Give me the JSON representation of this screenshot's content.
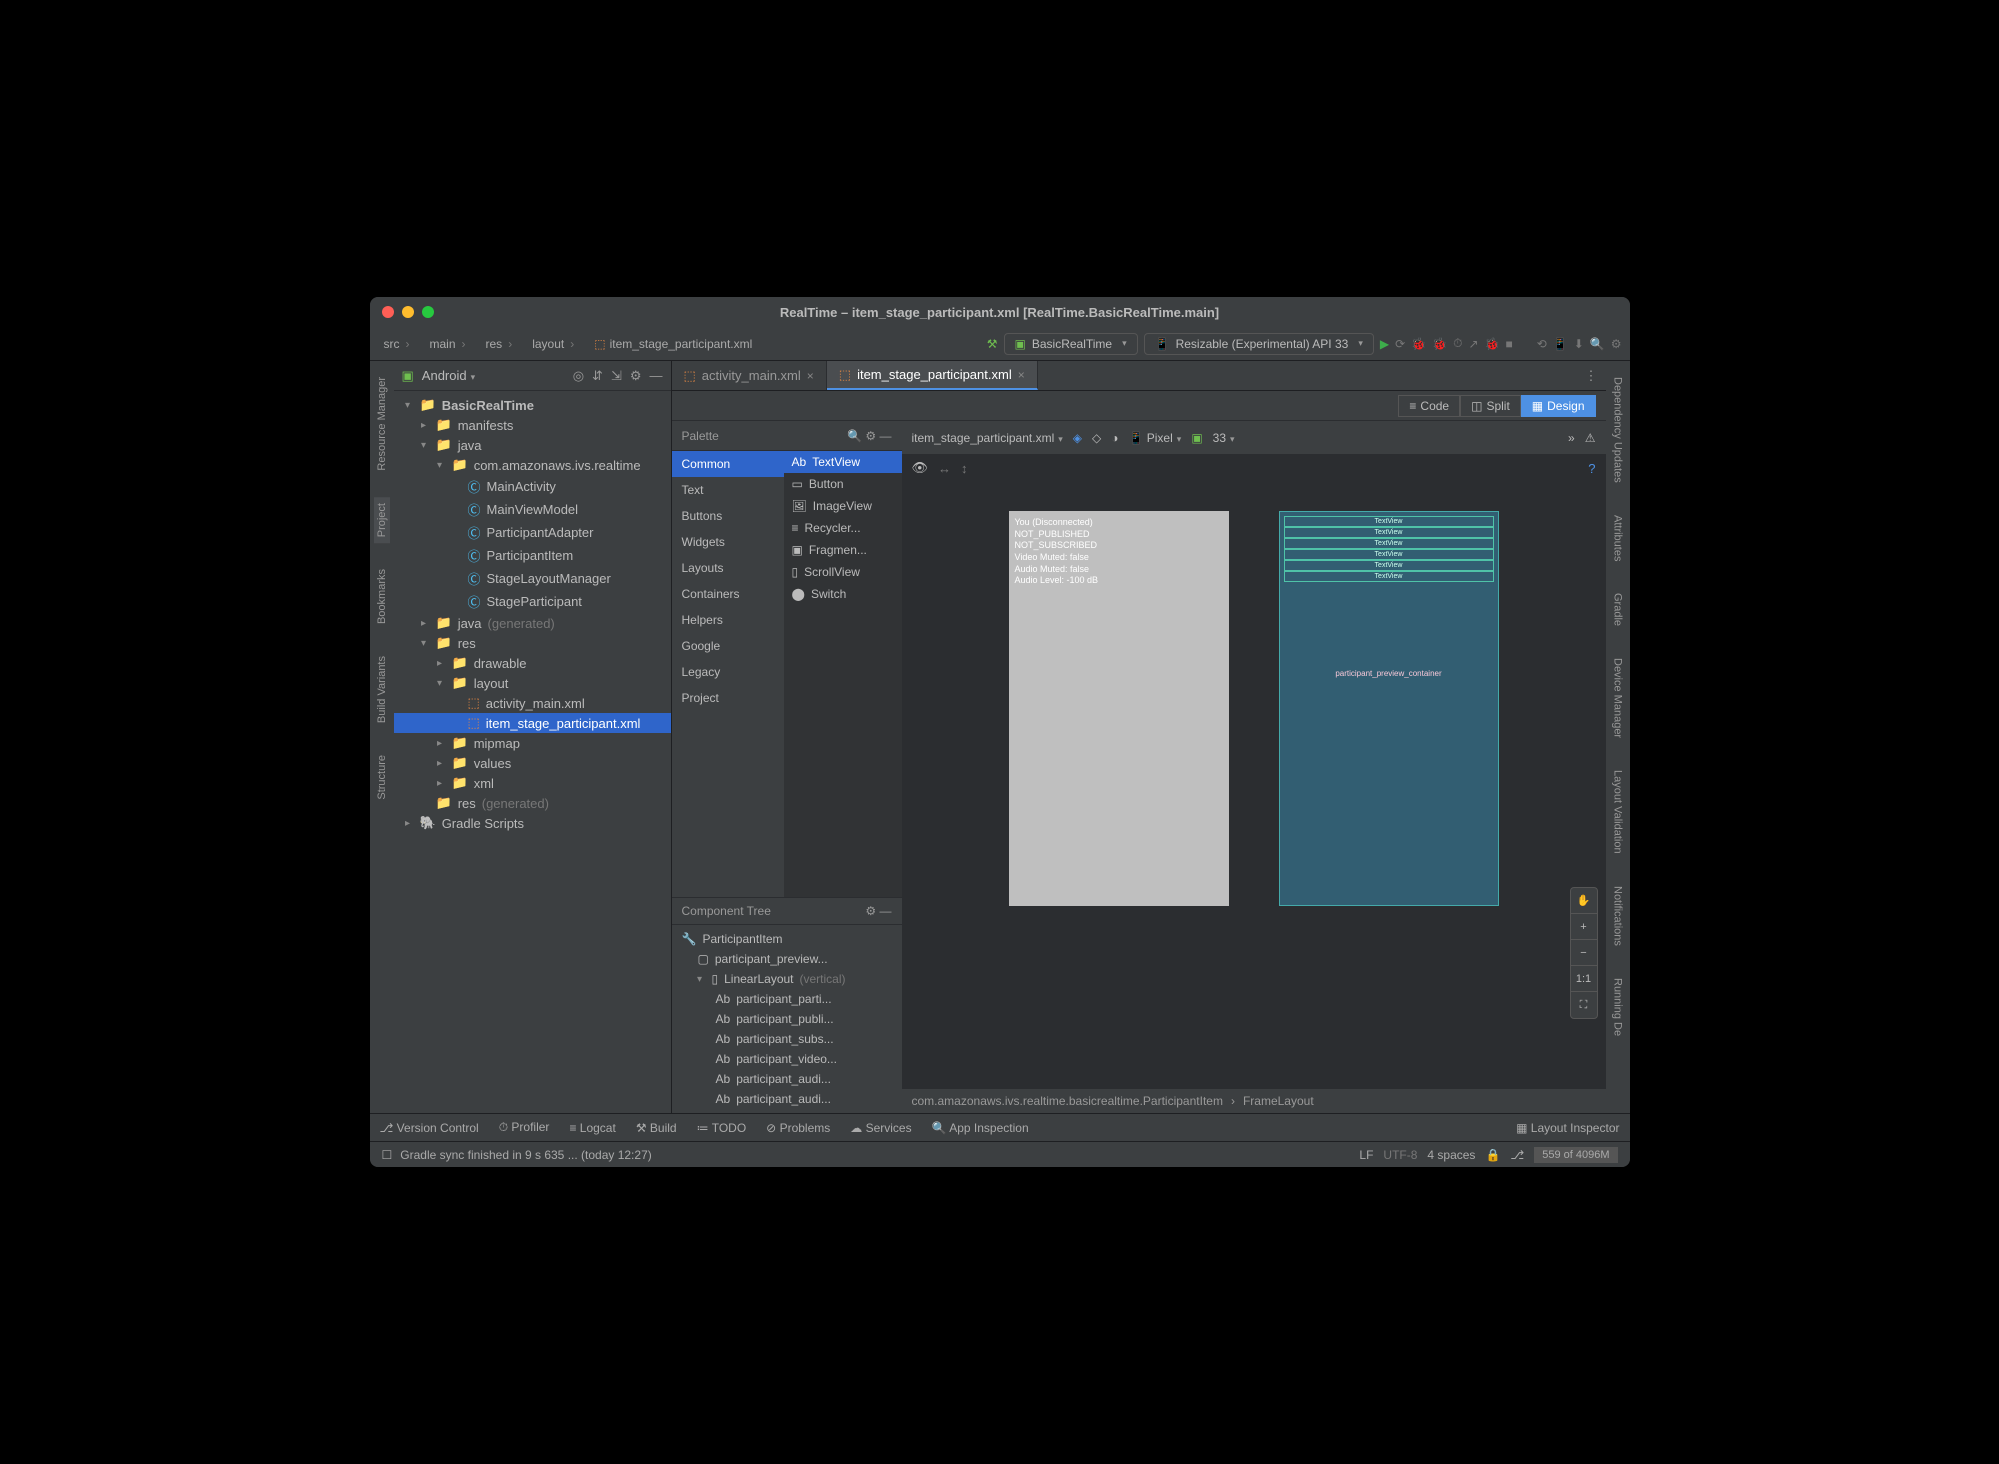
{
  "title": "RealTime – item_stage_participant.xml [RealTime.BasicRealTime.main]",
  "breadcrumb": [
    "src",
    "main",
    "res",
    "layout",
    "item_stage_participant.xml"
  ],
  "runConfig": "BasicRealTime",
  "deviceSel": "Resizable (Experimental) API 33",
  "projectDropdown": "Android",
  "tree": {
    "root": "BasicRealTime",
    "manifests": "manifests",
    "java": "java",
    "pkg": "com.amazonaws.ivs.realtime",
    "classes": [
      "MainActivity",
      "MainViewModel",
      "ParticipantAdapter",
      "ParticipantItem",
      "StageLayoutManager",
      "StageParticipant"
    ],
    "javaGen": "java",
    "javaGenSuffix": "(generated)",
    "res": "res",
    "drawable": "drawable",
    "layout": "layout",
    "layoutFiles": [
      "activity_main.xml",
      "item_stage_participant.xml"
    ],
    "mipmap": "mipmap",
    "values": "values",
    "xml": "xml",
    "resGen": "res",
    "resGenSuffix": "(generated)",
    "gradle": "Gradle Scripts"
  },
  "tabs": [
    "activity_main.xml",
    "item_stage_participant.xml"
  ],
  "activeTab": 1,
  "viewModes": [
    "Code",
    "Split",
    "Design"
  ],
  "activeMode": 2,
  "palette": {
    "title": "Palette",
    "categories": [
      "Common",
      "Text",
      "Buttons",
      "Widgets",
      "Layouts",
      "Containers",
      "Helpers",
      "Google",
      "Legacy",
      "Project"
    ],
    "items": [
      "TextView",
      "Button",
      "ImageView",
      "Recycler...",
      "Fragmen...",
      "ScrollView",
      "Switch"
    ]
  },
  "componentTree": {
    "title": "Component Tree",
    "root": "ParticipantItem",
    "fl": "participant_preview...",
    "ll": "LinearLayout",
    "llMod": "(vertical)",
    "children": [
      "participant_parti...",
      "participant_publi...",
      "participant_subs...",
      "participant_video...",
      "participant_audi...",
      "participant_audi..."
    ]
  },
  "canvasToolbar": {
    "file": "item_stage_participant.xml",
    "device": "Pixel",
    "api": "33"
  },
  "preview": {
    "lines": [
      "You (Disconnected)",
      "NOT_PUBLISHED",
      "NOT_SUBSCRIBED",
      "Video Muted: false",
      "Audio Muted: false",
      "Audio Level: -100 dB"
    ]
  },
  "blueprint": {
    "label": "participant_preview_container",
    "rows": [
      "TextView",
      "TextView",
      "TextView",
      "TextView",
      "TextView",
      "TextView"
    ]
  },
  "canvasBreadcrumb": [
    "com.amazonaws.ivs.realtime.basicrealtime.ParticipantItem",
    "FrameLayout"
  ],
  "bottomTools": [
    "Version Control",
    "Profiler",
    "Logcat",
    "Build",
    "TODO",
    "Problems",
    "Services",
    "App Inspection"
  ],
  "layoutInspector": "Layout Inspector",
  "status": {
    "msg": "Gradle sync finished in 9 s 635 ... (today 12:27)",
    "eol": "LF",
    "enc": "UTF-8",
    "indent": "4 spaces",
    "mem": "559 of 4096M"
  },
  "leftRail": [
    "Resource Manager",
    "Project",
    "Bookmarks",
    "Build Variants",
    "Structure"
  ],
  "rightRail": [
    "Dependency Updates",
    "Attributes",
    "Gradle",
    "Device Manager",
    "Layout Validation",
    "Notifications",
    "Running De"
  ]
}
